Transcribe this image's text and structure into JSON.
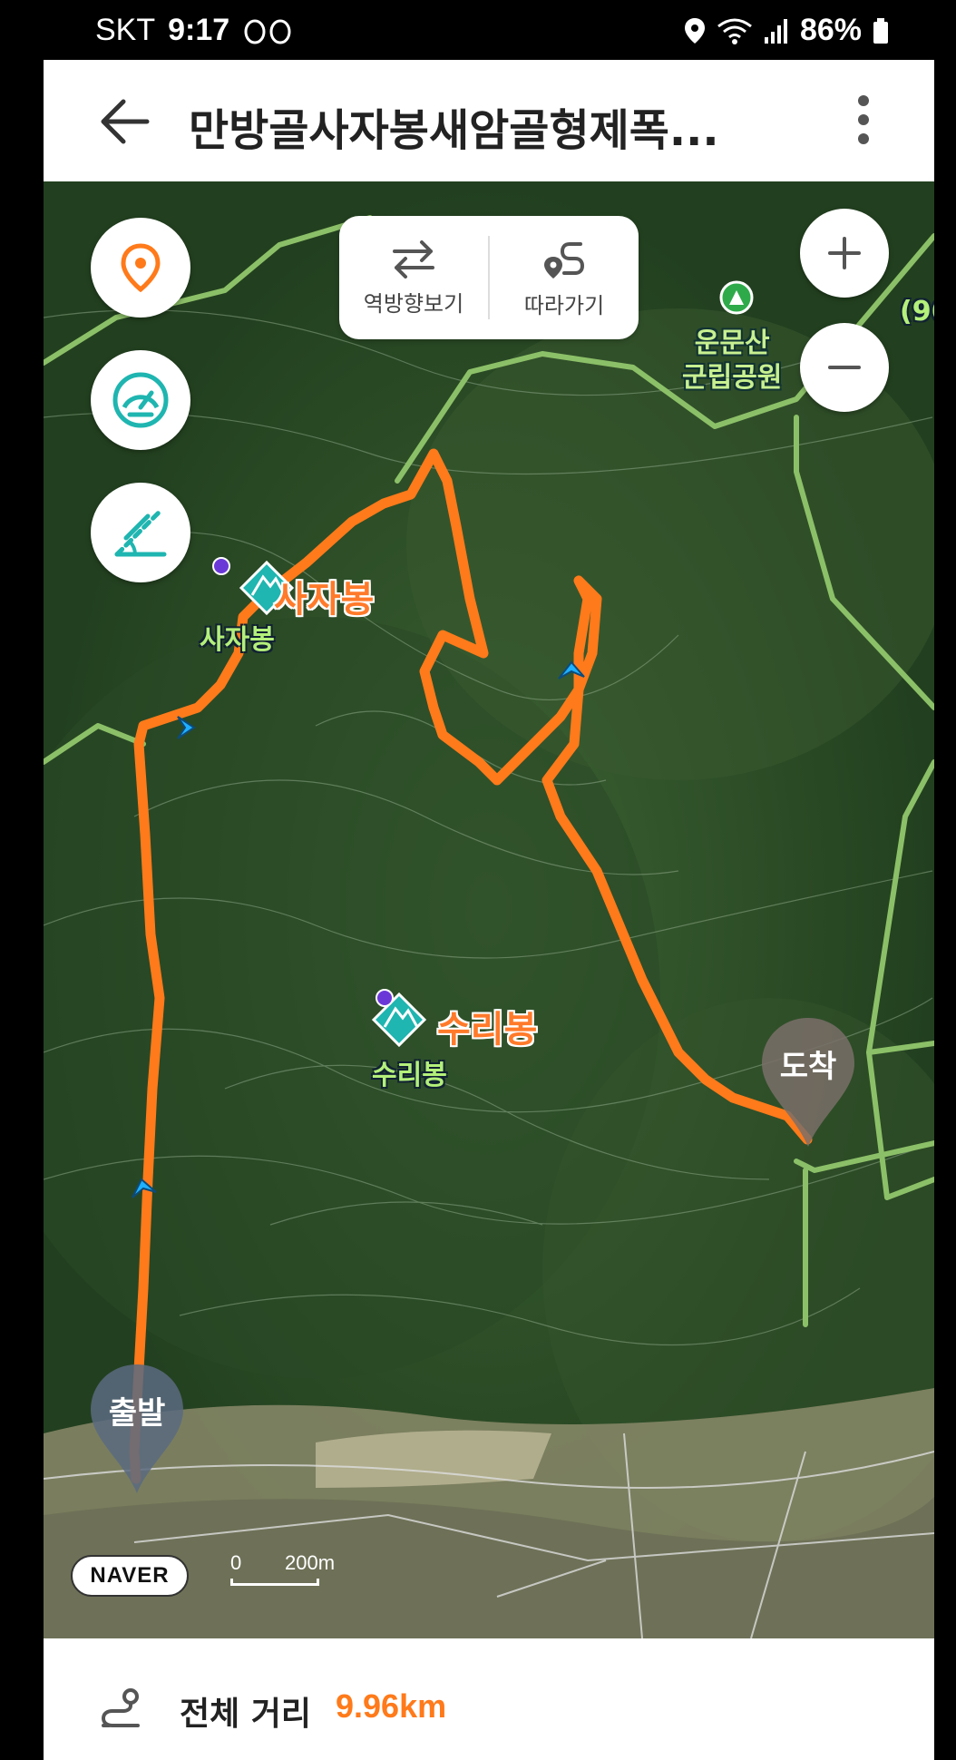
{
  "status_bar": {
    "carrier": "SKT",
    "time": "9:17",
    "battery": "86%"
  },
  "header": {
    "title": "만방골사자봉새암골형제폭..."
  },
  "map": {
    "toggle": {
      "reverse_label": "역방향보기",
      "follow_label": "따라가기"
    },
    "labels": {
      "peak1_orange": "사자봉",
      "peak1_green": "사자봉",
      "peak2_orange": "수리봉",
      "peak2_green": "수리봉",
      "park_line1": "운문산",
      "park_line2": "군립공원",
      "edge_text": "(96"
    },
    "markers": {
      "start": "출발",
      "end": "도착"
    },
    "logo": "NAVER",
    "scale": {
      "zero": "0",
      "distance": "200m"
    }
  },
  "summary": {
    "label": "전체 거리",
    "value": "9.96km"
  },
  "colors": {
    "accent": "#ff7a1a",
    "route": "#ff7a1a",
    "teal": "#1fb5b0",
    "trail": "#8cc068"
  }
}
